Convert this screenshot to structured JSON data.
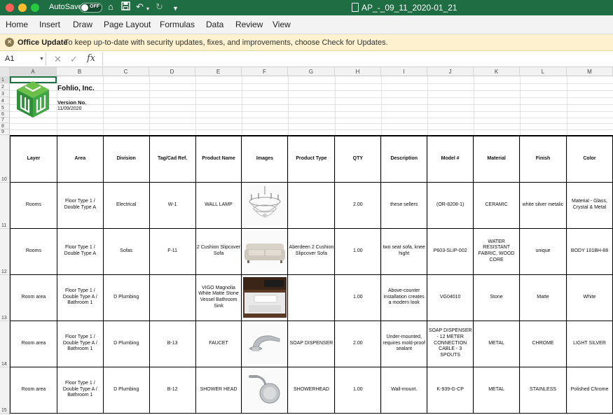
{
  "window": {
    "autosave_label": "AutoSave",
    "autosave_state": "OFF",
    "title": "AP_-_09_11_2020-01_21"
  },
  "ribbon": {
    "tabs": [
      "Home",
      "Insert",
      "Draw",
      "Page Layout",
      "Formulas",
      "Data",
      "Review",
      "View"
    ]
  },
  "update_bar": {
    "title": "Office Update",
    "message": "To keep up-to-date with security updates, fixes, and improvements, choose Check for Updates."
  },
  "formula_bar": {
    "name_box": "A1",
    "fx_label": "fx",
    "formula": ""
  },
  "columns": [
    "A",
    "B",
    "C",
    "D",
    "E",
    "F",
    "G",
    "H",
    "I",
    "J",
    "K",
    "L",
    "M"
  ],
  "rows": [
    "1",
    "2",
    "3",
    "4",
    "5",
    "6",
    "7",
    "8",
    "9",
    "10",
    "11",
    "12",
    "13",
    "14",
    "15"
  ],
  "header_block": {
    "company": "Fohlio, Inc.",
    "version_label": "Version No.",
    "date": "11/09/2020"
  },
  "table": {
    "headers": [
      "Layer",
      "Area",
      "Division",
      "Tag/Cad Ref.",
      "Product Name",
      "Images",
      "Product Type",
      "QTY",
      "Description",
      "Model #",
      "Material",
      "Finish",
      "Color"
    ],
    "rows": [
      [
        "Rooms",
        "Floor Type 1 / Double Type A",
        "Electrical",
        "W-1",
        "WALL LAMP",
        "",
        "",
        "2.00",
        "these sellers",
        "(OR-8208-1)",
        "CERAMIC",
        "white silver metalic",
        "Material - Glass, Crystal & Metal"
      ],
      [
        "Rooms",
        "Floor Type 1 / Double Type A",
        "Sofas",
        "F-11",
        "2 Cushion Slipcover Sofa",
        "",
        "Aberdeen 2 Cushion Slipcover Sofa",
        "1.00",
        "two seat sofa, knee hight",
        "P603-SLIP-002",
        "WATER RESISTANT FABRIC, WOOD CORE",
        "unique",
        "BODY 101BH-88"
      ],
      [
        "Room area",
        "Floor Type 1 / Double Type A / Bathroom 1",
        "D Plumbing",
        "",
        "VIGO Magnolia White Matte Stone Vessel Bathroom Sink",
        "",
        "",
        "1.00",
        "Above-counter installation creates a modern look",
        "VG04010",
        "Stone",
        "Matte",
        "White"
      ],
      [
        "Room area",
        "Floor Type 1 / Double Type A / Bathroom 1",
        "D Plumbing",
        "B-13",
        "FAUCET",
        "",
        "SOAP DISPENSER",
        "2.00",
        "Under-mounted, requires mold-proof sealant",
        "SOAP DISPENSER - 12 METER CONNECTION CABLE - 3 SPOUTS",
        "METAL",
        "CHROME",
        "LIGHT SILVER"
      ],
      [
        "Room area",
        "Floor Type 1 / Double Type A / Bathroom 1",
        "D Plumbing",
        "B-12",
        "SHOWER HEAD",
        "",
        "SHOWERHEAD",
        "1.00",
        "Wall-mount.",
        "K-939-G-CP",
        "METAL",
        "STAINLESS",
        "Polished Chrome"
      ]
    ],
    "images": [
      "chandelier-image",
      "sofa-image",
      "sink-image",
      "faucet-image",
      "showerhead-image"
    ]
  },
  "colors": {
    "title_bar": "#1f6e43",
    "selection": "#1e7145",
    "update_bar": "#fdf1cf",
    "logo_green": "#35a23f"
  }
}
